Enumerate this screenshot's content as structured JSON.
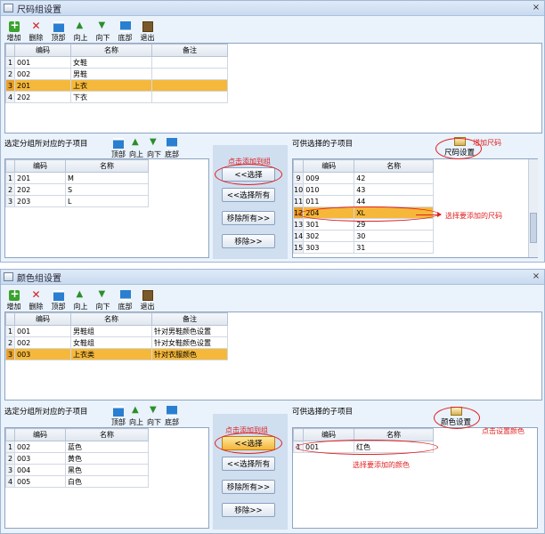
{
  "size_window": {
    "title": "尺码组设置",
    "toolbar": [
      "增加",
      "删除",
      "顶部",
      "向上",
      "向下",
      "底部",
      "退出"
    ],
    "groups_table": {
      "headers": [
        "编码",
        "名称",
        "备注"
      ],
      "rows": [
        {
          "n": "1",
          "code": "001",
          "name": "女鞋",
          "note": ""
        },
        {
          "n": "2",
          "code": "002",
          "name": "男鞋",
          "note": ""
        },
        {
          "n": "3",
          "code": "201",
          "name": "上衣",
          "note": "",
          "selected": true
        },
        {
          "n": "4",
          "code": "202",
          "name": "下衣",
          "note": ""
        }
      ]
    },
    "sub_label": "选定分组所对应的子项目",
    "mini_toolbar": [
      "顶部",
      "向上",
      "向下",
      "底部"
    ],
    "sub_table": {
      "headers": [
        "编码",
        "名称"
      ],
      "rows": [
        {
          "n": "1",
          "code": "201",
          "name": "M"
        },
        {
          "n": "2",
          "code": "202",
          "name": "S"
        },
        {
          "n": "3",
          "code": "203",
          "name": "L"
        }
      ]
    },
    "buttons": {
      "select": "<<选择",
      "select_all": "<<选择所有",
      "remove_all": "移除所有>>",
      "remove": "移除>>"
    },
    "avail_label": "可供选择的子项目",
    "setting_button": "尺码设置",
    "avail_table": {
      "headers": [
        "编码",
        "名称"
      ],
      "rows": [
        {
          "n": "9",
          "code": "009",
          "name": "42"
        },
        {
          "n": "10",
          "code": "010",
          "name": "43"
        },
        {
          "n": "11",
          "code": "011",
          "name": "44"
        },
        {
          "n": "12",
          "code": "204",
          "name": "XL",
          "selected": true
        },
        {
          "n": "13",
          "code": "301",
          "name": "29"
        },
        {
          "n": "14",
          "code": "302",
          "name": "30"
        },
        {
          "n": "15",
          "code": "303",
          "name": "31"
        }
      ]
    },
    "annotations": {
      "click_add": "点击添加到组",
      "add_size": "增加尺码",
      "select_size": "选择要添加的尺码"
    }
  },
  "color_window": {
    "title": "颜色组设置",
    "toolbar": [
      "增加",
      "删除",
      "顶部",
      "向上",
      "向下",
      "底部",
      "退出"
    ],
    "groups_table": {
      "headers": [
        "编码",
        "名称",
        "备注"
      ],
      "rows": [
        {
          "n": "1",
          "code": "001",
          "name": "男鞋组",
          "note": "针对男鞋颜色设置"
        },
        {
          "n": "2",
          "code": "002",
          "name": "女鞋组",
          "note": "针对女鞋颜色设置"
        },
        {
          "n": "3",
          "code": "003",
          "name": "上衣类",
          "note": "针对衣服颜色",
          "selected": true
        }
      ]
    },
    "sub_label": "选定分组所对应的子项目",
    "mini_toolbar": [
      "顶部",
      "向上",
      "向下",
      "底部"
    ],
    "sub_table": {
      "headers": [
        "编码",
        "名称"
      ],
      "rows": [
        {
          "n": "1",
          "code": "002",
          "name": "蓝色"
        },
        {
          "n": "2",
          "code": "003",
          "name": "黄色"
        },
        {
          "n": "3",
          "code": "004",
          "name": "黑色"
        },
        {
          "n": "4",
          "code": "005",
          "name": "白色"
        }
      ]
    },
    "buttons": {
      "select": "<<选择",
      "select_all": "<<选择所有",
      "remove_all": "移除所有>>",
      "remove": "移除>>"
    },
    "avail_label": "可供选择的子项目",
    "setting_button": "颜色设置",
    "avail_table": {
      "headers": [
        "编码",
        "名称"
      ],
      "rows": [
        {
          "n": "1",
          "code": "001",
          "name": "红色"
        }
      ]
    },
    "annotations": {
      "click_add": "点击添加到组",
      "click_setting": "点击设置颜色",
      "select_color": "选择要添加的颜色"
    }
  }
}
